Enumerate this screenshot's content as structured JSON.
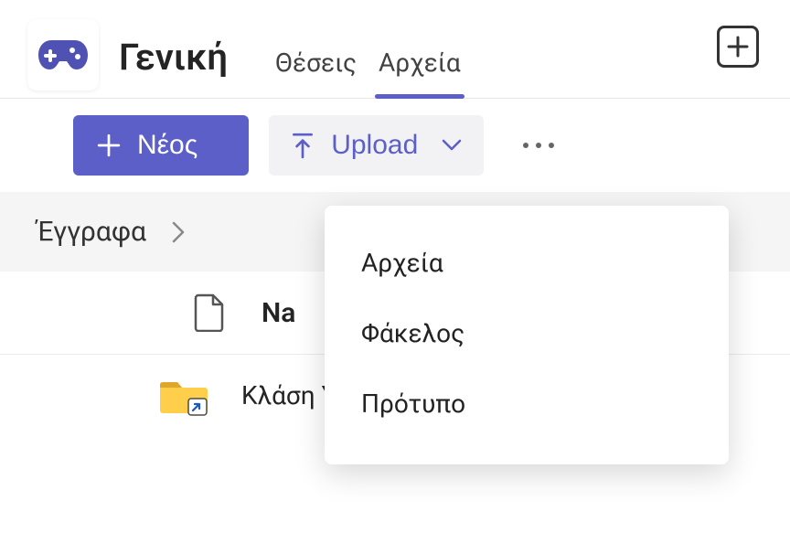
{
  "colors": {
    "accent": "#5b5fc7",
    "text": "#242424"
  },
  "header": {
    "channel_title": "Γενική",
    "tabs": [
      {
        "label": "Θέσεις",
        "active": false
      },
      {
        "label": "Αρχεία",
        "active": true
      }
    ]
  },
  "toolbar": {
    "new_label": "Νέος",
    "upload_label": "Upload"
  },
  "breadcrumb": {
    "root": "Έγγραφα"
  },
  "columns": {
    "name_header": "Na"
  },
  "items": [
    {
      "name": "Κλάση Υλικά",
      "type": "folder-shortcut"
    }
  ],
  "upload_menu": {
    "items": [
      {
        "label": "Αρχεία"
      },
      {
        "label": "Φάκελος"
      },
      {
        "label": "Πρότυπο"
      }
    ]
  }
}
